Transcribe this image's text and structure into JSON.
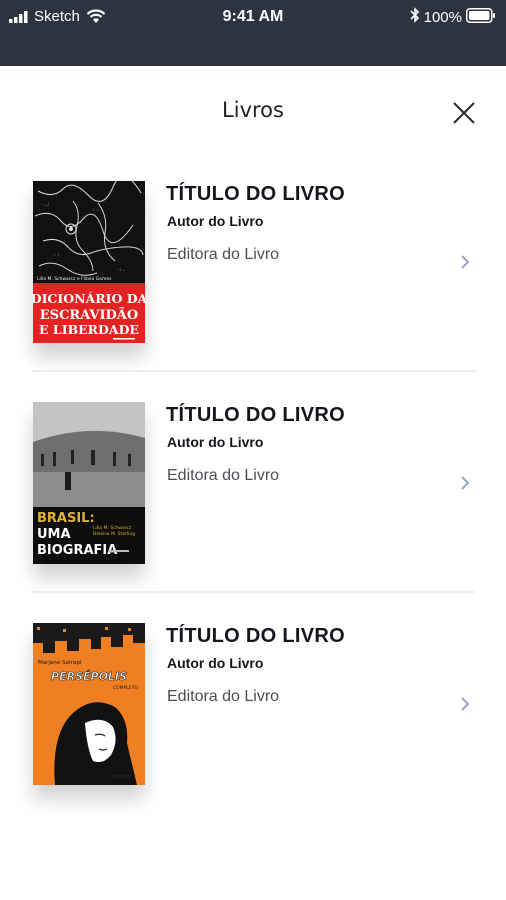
{
  "status_bar": {
    "carrier": "Sketch",
    "time": "9:41 AM",
    "battery": "100%"
  },
  "header": {
    "title": "Livros",
    "close_icon": "close-icon"
  },
  "books": [
    {
      "title": "TÍTULO DO LIVRO",
      "author": "Autor do Livro",
      "publisher": "Editora do Livro",
      "cover": {
        "top_text": "Lilia M. Schwarcz e Flávio Gomes",
        "main_text": [
          "DICIONÁRIO DA",
          "ESCRAVIDÃO",
          "E LIBERDADE"
        ]
      }
    },
    {
      "title": "TÍTULO DO LIVRO",
      "author": "Autor do Livro",
      "publisher": "Editora do Livro",
      "cover": {
        "word1": "BRASIL:",
        "word2": "UMA",
        "word3": "BIOGRAFIA",
        "authors": [
          "Lilia M. Schwarcz",
          "Heloisa M. Starling"
        ]
      }
    },
    {
      "title": "TÍTULO DO LIVRO",
      "author": "Autor do Livro",
      "publisher": "Editora do Livro",
      "cover": {
        "author": "Marjane Satrapi",
        "main_text": "PERSÉPOLIS",
        "subtitle": "COMPLETO"
      }
    }
  ],
  "colors": {
    "status_bar": "#2d3440",
    "cover1_red": "#e32322",
    "cover3_orange": "#f07f24",
    "cover2_yellow": "#e2b036",
    "chevron": "#9aa3c6"
  },
  "icons": {
    "chevron": "chevron-right-icon"
  }
}
